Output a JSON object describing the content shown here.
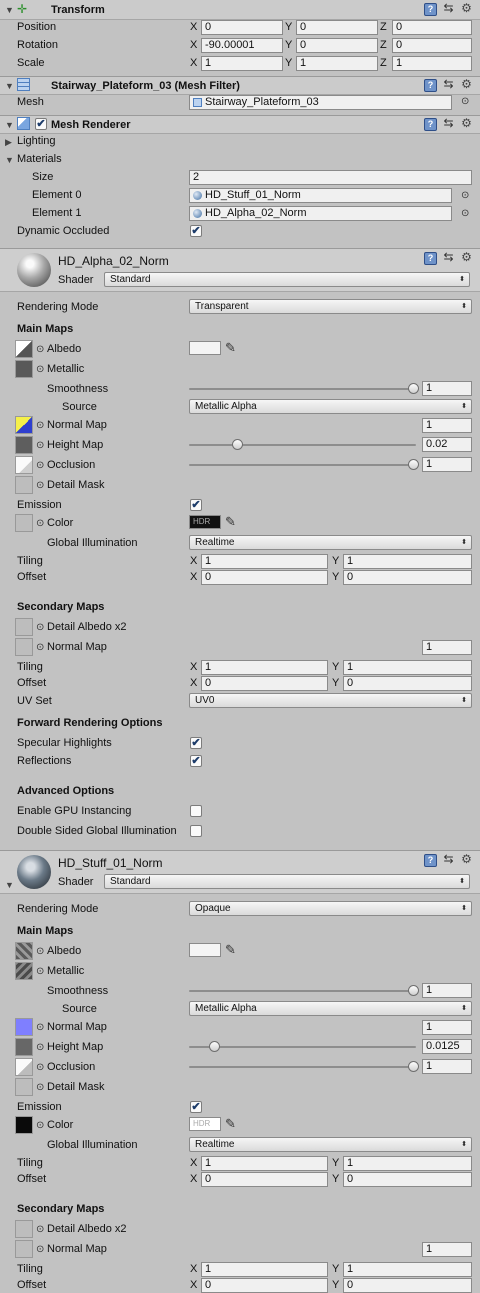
{
  "transform": {
    "title": "Transform",
    "rows": [
      {
        "label": "Position",
        "x": "0",
        "y": "0",
        "z": "0"
      },
      {
        "label": "Rotation",
        "x": "-90.00001",
        "y": "0",
        "z": "0"
      },
      {
        "label": "Scale",
        "x": "1",
        "y": "1",
        "z": "1"
      }
    ]
  },
  "axes": {
    "x": "X",
    "y": "Y",
    "z": "Z"
  },
  "mesh_filter": {
    "title": "Stairway_Plateform_03 (Mesh Filter)",
    "mesh_label": "Mesh",
    "mesh_value": "Stairway_Plateform_03"
  },
  "mesh_renderer": {
    "title": "Mesh Renderer",
    "lighting": "Lighting",
    "materials": "Materials",
    "size_label": "Size",
    "size_value": "2",
    "element0_label": "Element 0",
    "element0_value": "HD_Stuff_01_Norm",
    "element1_label": "Element 1",
    "element1_value": "HD_Alpha_02_Norm",
    "dynamic_occluded": "Dynamic Occluded"
  },
  "mat1": {
    "name": "HD_Alpha_02_Norm",
    "shader_label": "Shader",
    "shader": "Standard",
    "rendering_mode_label": "Rendering Mode",
    "rendering_mode": "Transparent",
    "main_maps": "Main Maps",
    "albedo": "Albedo",
    "metallic": "Metallic",
    "smoothness": "Smoothness",
    "smoothness_value": "1",
    "source_label": "Source",
    "source": "Metallic Alpha",
    "normal_map": "Normal Map",
    "normal_value": "1",
    "height_map": "Height Map",
    "height_value": "0.02",
    "occlusion": "Occlusion",
    "occlusion_value": "1",
    "detail_mask": "Detail Mask",
    "emission": "Emission",
    "color": "Color",
    "hdr": "HDR",
    "gi_label": "Global Illumination",
    "gi": "Realtime",
    "tiling": "Tiling",
    "tiling_x": "1",
    "tiling_y": "1",
    "offset": "Offset",
    "offset_x": "0",
    "offset_y": "0",
    "secondary_maps": "Secondary Maps",
    "detail_albedo": "Detail Albedo x2",
    "normal_map2": "Normal Map",
    "normal2_value": "1",
    "tiling2_x": "1",
    "tiling2_y": "1",
    "offset2_x": "0",
    "offset2_y": "0",
    "uvset_label": "UV Set",
    "uvset": "UV0",
    "forward": "Forward Rendering Options",
    "specular": "Specular Highlights",
    "reflections": "Reflections",
    "advanced": "Advanced Options",
    "gpu_instancing": "Enable GPU Instancing",
    "double_sided": "Double Sided Global Illumination"
  },
  "mat2": {
    "name": "HD_Stuff_01_Norm",
    "shader_label": "Shader",
    "shader": "Standard",
    "rendering_mode_label": "Rendering Mode",
    "rendering_mode": "Opaque",
    "main_maps": "Main Maps",
    "albedo": "Albedo",
    "metallic": "Metallic",
    "smoothness": "Smoothness",
    "smoothness_value": "1",
    "source_label": "Source",
    "source": "Metallic Alpha",
    "normal_map": "Normal Map",
    "normal_value": "1",
    "height_map": "Height Map",
    "height_value": "0.0125",
    "occlusion": "Occlusion",
    "occlusion_value": "1",
    "detail_mask": "Detail Mask",
    "emission": "Emission",
    "color": "Color",
    "hdr": "HDR",
    "gi_label": "Global Illumination",
    "gi": "Realtime",
    "tiling": "Tiling",
    "tiling_x": "1",
    "tiling_y": "1",
    "offset": "Offset",
    "offset_x": "0",
    "offset_y": "0",
    "secondary_maps": "Secondary Maps",
    "detail_albedo": "Detail Albedo x2",
    "normal_map2": "Normal Map",
    "normal2_value": "1",
    "tiling2_x": "1",
    "tiling2_y": "1",
    "offset2_x": "0",
    "offset2_y": "0"
  },
  "icons": {
    "help": "?",
    "preset": "⇆",
    "gear": "⚙",
    "dot": "⊙",
    "check": "✔",
    "down": "▼",
    "right": "▶",
    "updown": "⬍",
    "picker": "✎"
  },
  "colors": {
    "background": "#c2c2c2",
    "header": "#cbcbcb",
    "help_blue": "#6f93c9",
    "normal_map_blue": "#7f7fff"
  },
  "smoothness_level": 1.0,
  "height_level_1": 0.24,
  "height_level_2": 0.12,
  "occlusion_level": 1.0
}
